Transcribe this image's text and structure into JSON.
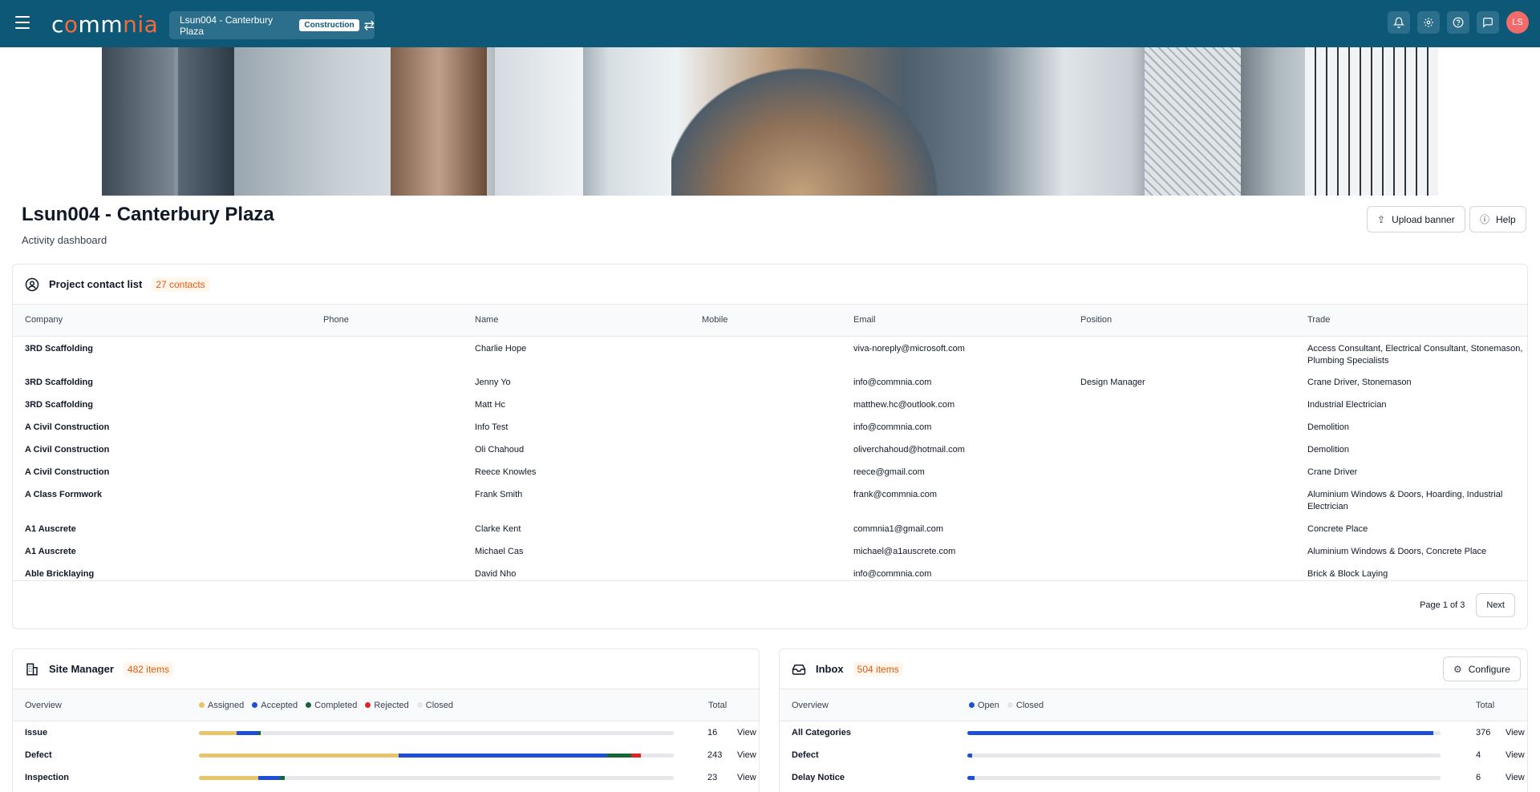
{
  "topbar": {
    "logo_prefix": "c",
    "logo_o": "o",
    "logo_mid": "mm",
    "logo_accent": "nia",
    "project_name": "Lsun004 - Canterbury Plaza",
    "project_stage": "Construction",
    "icons": [
      "bell-icon",
      "gear-icon",
      "help-icon",
      "chat-icon"
    ],
    "avatar_initials": "LS",
    "colors": {
      "bar": "#0d5876",
      "accent": "#f26b3a",
      "avatar": "#f26b6b"
    }
  },
  "page": {
    "title": "Lsun004 - Canterbury Plaza",
    "subtitle": "Activity dashboard",
    "upload_banner_label": "Upload banner",
    "help_label": "Help"
  },
  "contacts": {
    "title": "Project contact list",
    "count_label": "27 contacts",
    "columns": [
      "Company",
      "Phone",
      "Name",
      "Mobile",
      "Email",
      "Position",
      "Trade"
    ],
    "rows": [
      {
        "company": "3RD Scaffolding",
        "phone": "",
        "name": "Charlie Hope",
        "mobile": "",
        "email": "viva-noreply@microsoft.com",
        "position": "",
        "trade": "Access Consultant, Electrical Consultant, Stonemason, Plumbing Specialists"
      },
      {
        "company": "3RD Scaffolding",
        "phone": "",
        "name": "Jenny Yo",
        "mobile": "",
        "email": "info@commnia.com",
        "position": "Design Manager",
        "trade": "Crane Driver, Stonemason"
      },
      {
        "company": "3RD Scaffolding",
        "phone": "",
        "name": "Matt Hc",
        "mobile": "",
        "email": "matthew.hc@outlook.com",
        "position": "",
        "trade": "Industrial Electrician"
      },
      {
        "company": "A Civil Construction",
        "phone": "",
        "name": "Info Test",
        "mobile": "",
        "email": "info@commnia.com",
        "position": "",
        "trade": "Demolition"
      },
      {
        "company": "A Civil Construction",
        "phone": "",
        "name": "Oli Chahoud",
        "mobile": "",
        "email": "oliverchahoud@hotmail.com",
        "position": "",
        "trade": "Demolition"
      },
      {
        "company": "A Civil Construction",
        "phone": "",
        "name": "Reece Knowles",
        "mobile": "",
        "email": "reece@gmail.com",
        "position": "",
        "trade": "Crane Driver"
      },
      {
        "company": "A Class Formwork",
        "phone": "",
        "name": "Frank Smith",
        "mobile": "",
        "email": "frank@commnia.com",
        "position": "",
        "trade": "Aluminium Windows & Doors, Hoarding, Industrial Electrician"
      },
      {
        "company": "A1 Auscrete",
        "phone": "",
        "name": "Clarke Kent",
        "mobile": "",
        "email": "commnia1@gmail.com",
        "position": "",
        "trade": "Concrete Place"
      },
      {
        "company": "A1 Auscrete",
        "phone": "",
        "name": "Michael Cas",
        "mobile": "",
        "email": "michael@a1auscrete.com",
        "position": "",
        "trade": "Aluminium Windows & Doors, Concrete Place"
      },
      {
        "company": "Able Bricklaying",
        "phone": "",
        "name": "David Nho",
        "mobile": "",
        "email": "info@commnia.com",
        "position": "",
        "trade": "Brick & Block Laying"
      }
    ],
    "page_label": "Page 1 of 3",
    "next_label": "Next"
  },
  "site_manager": {
    "title": "Site Manager",
    "count_label": "482 items",
    "overview_label": "Overview",
    "total_label": "Total",
    "view_label": "View",
    "legend": [
      {
        "name": "Assigned",
        "color": "#e9c46a"
      },
      {
        "name": "Accepted",
        "color": "#1d4ed8"
      },
      {
        "name": "Completed",
        "color": "#166534"
      },
      {
        "name": "Rejected",
        "color": "#dc2626"
      },
      {
        "name": "Closed",
        "color": "#e5e7eb"
      }
    ],
    "rows": [
      {
        "label": "Issue",
        "total": "16",
        "segments": [
          0.08,
          0.045,
          0.005,
          0,
          0.87
        ]
      },
      {
        "label": "Defect",
        "total": "243",
        "segments": [
          0.42,
          0.44,
          0.05,
          0.02,
          0.07
        ]
      },
      {
        "label": "Inspection",
        "total": "23",
        "segments": [
          0.125,
          0.045,
          0.01,
          0,
          0.82
        ]
      }
    ]
  },
  "inbox": {
    "title": "Inbox",
    "count_label": "504 items",
    "configure_label": "Configure",
    "overview_label": "Overview",
    "total_label": "Total",
    "view_label": "View",
    "legend": [
      {
        "name": "Open",
        "color": "#1d4ed8"
      },
      {
        "name": "Closed",
        "color": "#e5e7eb"
      }
    ],
    "rows": [
      {
        "label": "All Categories",
        "total": "376",
        "segments": [
          0.985,
          0.015
        ]
      },
      {
        "label": "Defect",
        "total": "4",
        "segments": [
          0.01,
          0.99
        ]
      },
      {
        "label": "Delay Notice",
        "total": "6",
        "segments": [
          0.015,
          0.985
        ]
      }
    ]
  }
}
